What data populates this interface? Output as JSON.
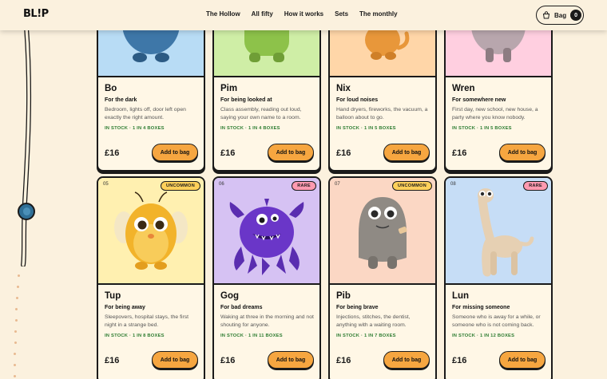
{
  "nav": {
    "logo": "BL!P",
    "links": [
      "The Hollow",
      "All fifty",
      "How it works",
      "Sets",
      "The monthly"
    ],
    "bag_label": "Bag",
    "bag_count": "0"
  },
  "row1": [
    {
      "name": "Bo",
      "tag": "For the dark",
      "desc": "Bedroom, lights off, door left open exactly the right amount.",
      "stock": "IN STOCK · 1 IN 4 BOXES",
      "price": "£16",
      "cta": "Add  to bag",
      "art_color": "#b8dcf5"
    },
    {
      "name": "Pim",
      "tag": "For being looked at",
      "desc": "Class assembly, reading out loud, saying your own name to a room.",
      "stock": "IN STOCK · 1 IN 4 BOXES",
      "price": "£16",
      "cta": "Add  to bag",
      "art_color": "#cfeea6"
    },
    {
      "name": "Nix",
      "tag": "For loud noises",
      "desc": "Hand dryers, fireworks, the vacuum, a balloon about to go.",
      "stock": "IN STOCK · 1 IN 5 BOXES",
      "price": "£16",
      "cta": "Add  to bag",
      "art_color": "#ffd6a8"
    },
    {
      "name": "Wren",
      "tag": "For somewhere new",
      "desc": "First day, new school, new house, a party where you know nobody.",
      "stock": "IN STOCK · 1 IN 5 BOXES",
      "price": "£16",
      "cta": "Add  to bag",
      "art_color": "#ffcfe0"
    }
  ],
  "row2": [
    {
      "num": "05",
      "badge": "UNCOMMON",
      "name": "Tup",
      "tag": "For being away",
      "desc": "Sleepovers, hospital stays, the first night in a strange bed.",
      "stock": "IN STOCK · 1 IN 8 BOXES",
      "price": "£16",
      "cta": "Add  to bag",
      "art_color": "#fff0b0"
    },
    {
      "num": "06",
      "badge": "RARE",
      "name": "Gog",
      "tag": "For bad dreams",
      "desc": "Waking at three in the morning and not shouting for anyone.",
      "stock": "IN STOCK · 1 IN 11 BOXES",
      "price": "£16",
      "cta": "Add  to bag",
      "art_color": "#d6c2f3"
    },
    {
      "num": "07",
      "badge": "UNCOMMON",
      "name": "Pib",
      "tag": "For being brave",
      "desc": "Injections, stitches, the dentist, anything with a waiting room.",
      "stock": "IN STOCK · 1 IN 7 BOXES",
      "price": "£16",
      "cta": "Add  to bag",
      "art_color": "#fbd7c4"
    },
    {
      "num": "08",
      "badge": "RARE",
      "name": "Lun",
      "tag": "For missing someone",
      "desc": "Someone who is away for a while, or someone who is not coming back.",
      "stock": "IN STOCK · 1 IN 12 BOXES",
      "price": "£16",
      "cta": "Add  to bag",
      "art_color": "#c6ddf6"
    }
  ],
  "colors": {
    "accent": "#f6a640",
    "ink": "#1a1a1a",
    "stock": "#2e7d32",
    "uncommon": "#ffd05a",
    "rare": "#ff9ab0"
  }
}
